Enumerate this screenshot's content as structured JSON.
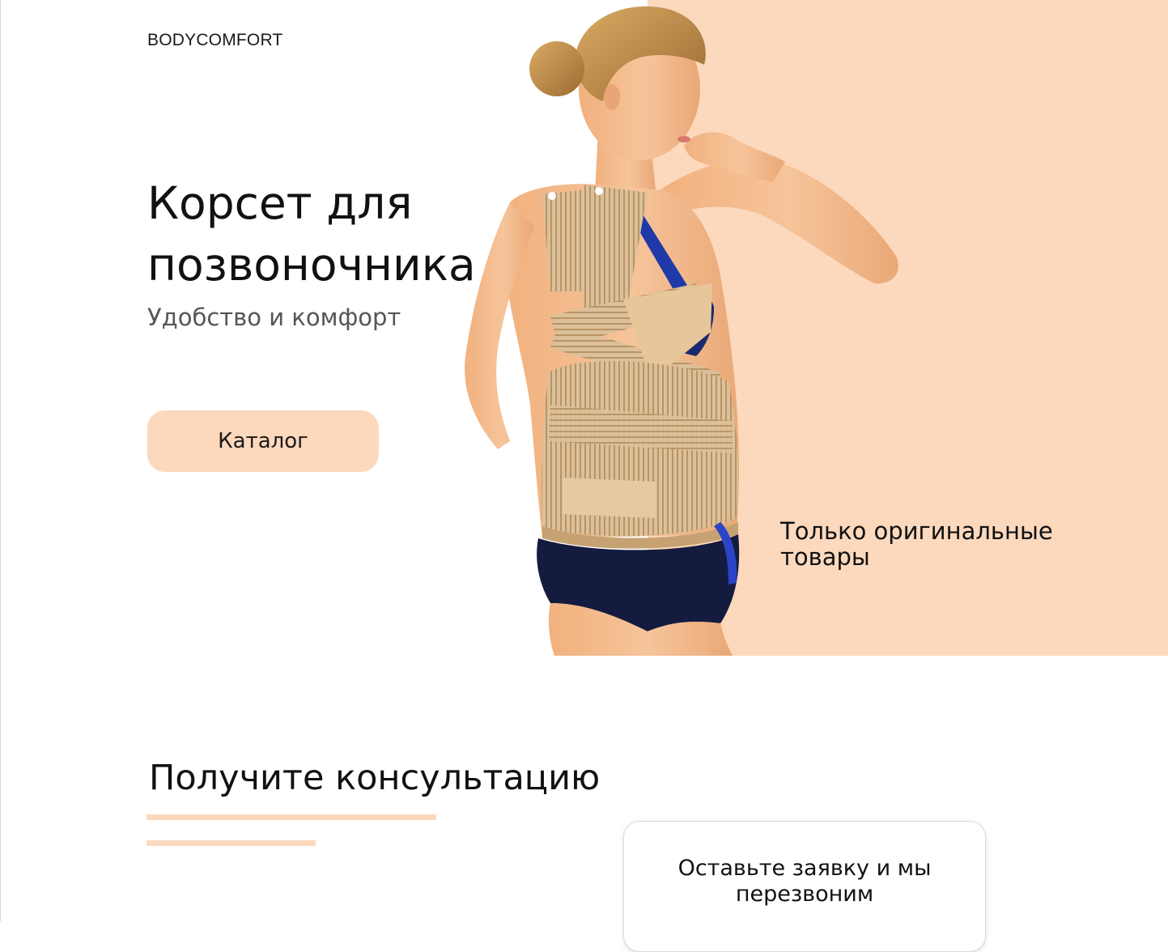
{
  "header": {
    "logo_text": "BODYCOMFORT"
  },
  "hero": {
    "title": "Корсет для позвоночника",
    "subtitle": "Удобство и комфорт",
    "catalog_button_label": "Каталог",
    "original_note": "Только оригинальные товары"
  },
  "consultation": {
    "title": "Получите консультацию",
    "card_text": "Оставьте заявку и мы перезвоним"
  },
  "colors": {
    "accent_peach": "#fcd8bd",
    "text_dark": "#111111",
    "text_muted": "#555555",
    "background": "#ffffff"
  }
}
